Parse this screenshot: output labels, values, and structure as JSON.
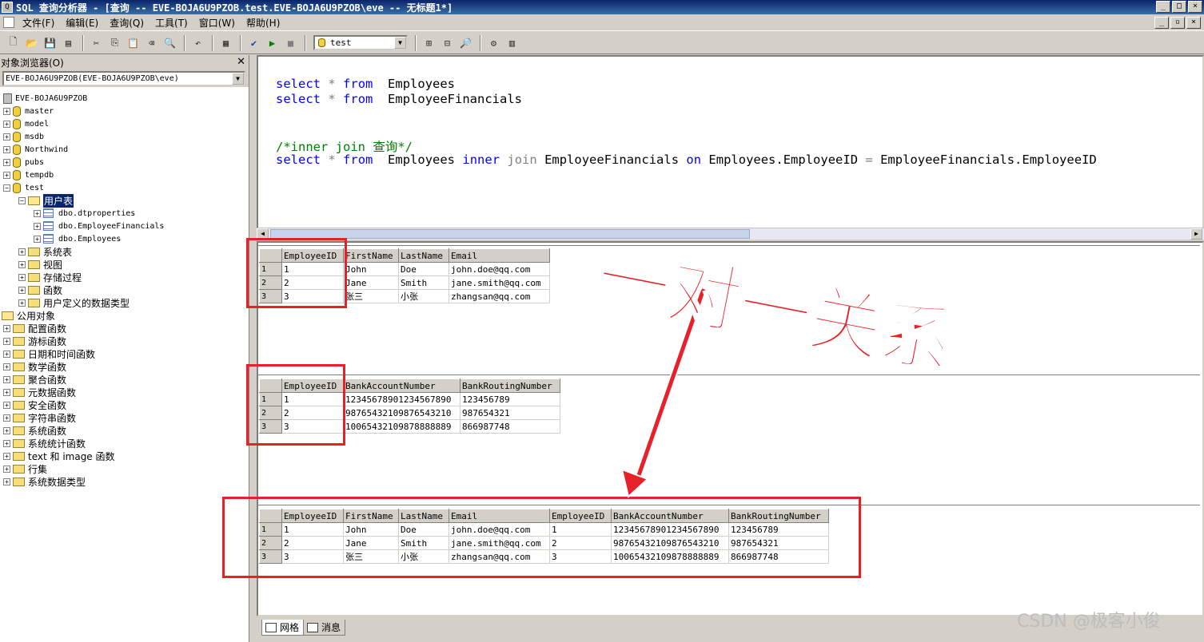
{
  "window": {
    "title": "SQL 查询分析器 - [查询 -- EVE-BOJA6U9PZOB.test.EVE-BOJA6U9PZOB\\eve -- 无标题1*]"
  },
  "menu": [
    "文件(F)",
    "编辑(E)",
    "查询(Q)",
    "工具(T)",
    "窗口(W)",
    "帮助(H)"
  ],
  "toolbar": {
    "database": "test"
  },
  "object_browser": {
    "title": "对象浏览器(O)",
    "connection": "EVE-BOJA6U9PZOB(EVE-BOJA6U9PZOB\\eve)",
    "server": "EVE-BOJA6U9PZOB",
    "databases": [
      "master",
      "model",
      "msdb",
      "Northwind",
      "pubs",
      "tempdb",
      "test"
    ],
    "user_tables": "用户表",
    "tables": [
      "dbo.dtproperties",
      "dbo.EmployeeFinancials",
      "dbo.Employees"
    ],
    "test_folders": [
      "系统表",
      "视图",
      "存储过程",
      "函数",
      "用户定义的数据类型"
    ],
    "common_objects": "公用对象",
    "common_folders": [
      "配置函数",
      "游标函数",
      "日期和时间函数",
      "数学函数",
      "聚合函数",
      "元数据函数",
      "安全函数",
      "字符串函数",
      "系统函数",
      "系统统计函数",
      "text 和 image 函数",
      "行集",
      "系统数据类型"
    ]
  },
  "editor": {
    "line1": {
      "kw1": "select",
      "star": "*",
      "kw2": "from",
      "rest": "Employees"
    },
    "line2": {
      "kw1": "select",
      "star": "*",
      "kw2": "from",
      "rest": "EmployeeFinancials"
    },
    "comment": "/*inner join 查询*/",
    "line3": {
      "kw1": "select",
      "star": "*",
      "kw2": "from",
      "t1": "Employees",
      "kw3": "inner",
      "kw4": "join",
      "t2": "EmployeeFinancials",
      "kw5": "on",
      "c1": "Employees.EmployeeID",
      "eq": "=",
      "c2": "EmployeeFinancials.EmployeeID"
    }
  },
  "results": {
    "employees": {
      "columns": [
        "EmployeeID",
        "FirstName",
        "LastName",
        "Email"
      ],
      "rows": [
        [
          "1",
          "John",
          "Doe",
          "john.doe@qq.com"
        ],
        [
          "2",
          "Jane",
          "Smith",
          "jane.smith@qq.com"
        ],
        [
          "3",
          "张三",
          "小张",
          "zhangsan@qq.com"
        ]
      ]
    },
    "financials": {
      "columns": [
        "EmployeeID",
        "BankAccountNumber",
        "BankRoutingNumber"
      ],
      "rows": [
        [
          "1",
          "12345678901234567890",
          "123456789"
        ],
        [
          "2",
          "98765432109876543210",
          "987654321"
        ],
        [
          "3",
          "10065432109878888889",
          "866987748"
        ]
      ]
    },
    "joined": {
      "columns": [
        "EmployeeID",
        "FirstName",
        "LastName",
        "Email",
        "EmployeeID",
        "BankAccountNumber",
        "BankRoutingNumber"
      ],
      "rows": [
        [
          "1",
          "John",
          "Doe",
          "john.doe@qq.com",
          "1",
          "12345678901234567890",
          "123456789"
        ],
        [
          "2",
          "Jane",
          "Smith",
          "jane.smith@qq.com",
          "2",
          "98765432109876543210",
          "987654321"
        ],
        [
          "3",
          "张三",
          "小张",
          "zhangsan@qq.com",
          "3",
          "10065432109878888889",
          "866987748"
        ]
      ]
    },
    "row_numbers": [
      "1",
      "2",
      "3"
    ]
  },
  "tabs": {
    "grid": "网格",
    "messages": "消息"
  },
  "annotation": {
    "text": "一对一关系",
    "color": "#e62129"
  },
  "watermark": "CSDN @极客小俊"
}
